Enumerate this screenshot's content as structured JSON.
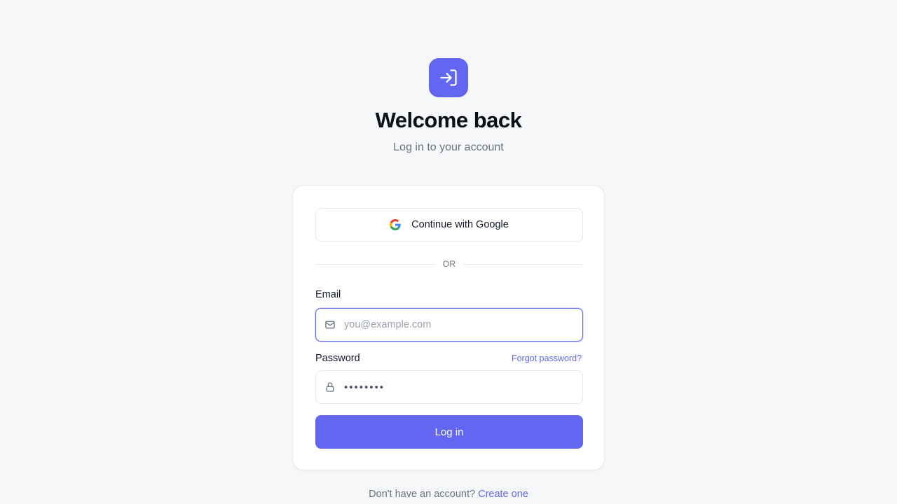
{
  "header": {
    "icon": "login-arrow-icon",
    "title": "Welcome back",
    "subtitle": "Log in to your account"
  },
  "google_button": {
    "icon": "google-icon",
    "label": "Continue with Google"
  },
  "divider": {
    "label": "OR"
  },
  "email": {
    "label": "Email",
    "icon": "mail-icon",
    "placeholder": "you@example.com",
    "value": ""
  },
  "password": {
    "label": "Password",
    "icon": "lock-icon",
    "forgot_label": "Forgot password?",
    "value": "••••••••"
  },
  "login_button": {
    "label": "Log in"
  },
  "footer": {
    "prompt": "Don't have an account?",
    "link": "Create one"
  },
  "colors": {
    "accent": "#6366f1",
    "background": "#f6f7f9",
    "card": "#ffffff",
    "border": "#e5e7eb",
    "muted_text": "#6b7280"
  }
}
